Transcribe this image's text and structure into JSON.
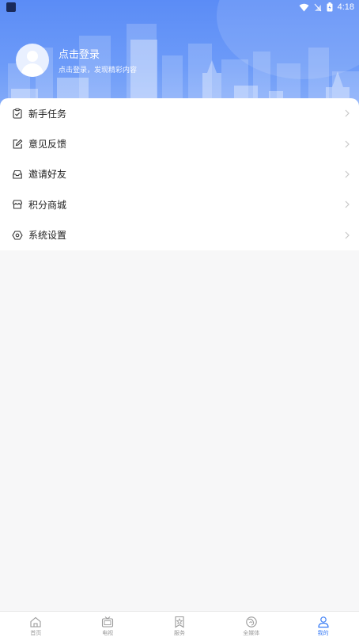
{
  "status_bar": {
    "time": "4:18"
  },
  "profile": {
    "login_title": "点击登录",
    "login_subtitle": "点击登录，发现精彩内容"
  },
  "menu": {
    "items": [
      {
        "label": "新手任务",
        "icon": "clipboard-check-icon"
      },
      {
        "label": "意见反馈",
        "icon": "edit-icon"
      },
      {
        "label": "邀请好友",
        "icon": "inbox-icon"
      },
      {
        "label": "积分商城",
        "icon": "store-icon"
      },
      {
        "label": "系统设置",
        "icon": "settings-icon"
      }
    ]
  },
  "bottom_nav": {
    "items": [
      {
        "label": "首页",
        "icon": "home-icon"
      },
      {
        "label": "电视",
        "icon": "tv-icon"
      },
      {
        "label": "服务",
        "icon": "bookmark-star-icon"
      },
      {
        "label": "全媒体",
        "icon": "media-icon"
      },
      {
        "label": "我的",
        "icon": "user-icon"
      }
    ],
    "active_index": 4
  },
  "colors": {
    "accent": "#3a7df6",
    "header": "#5b8cf6"
  }
}
